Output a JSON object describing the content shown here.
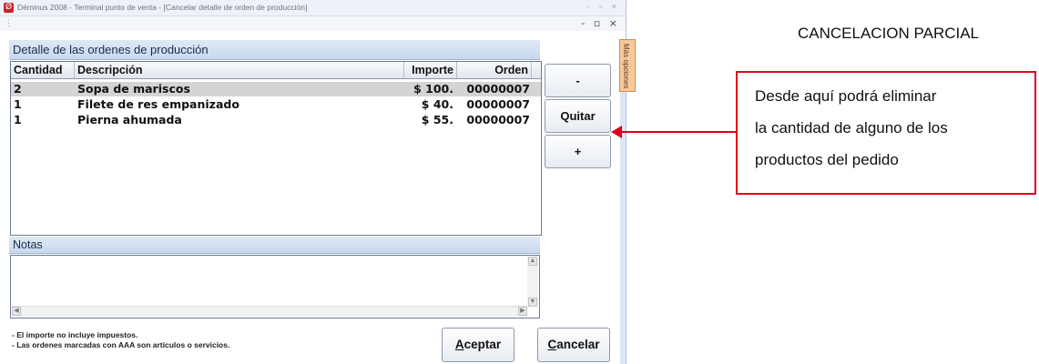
{
  "window": {
    "title": "Déminus 2008 - Terminal punto de venta - [Cancelar detalle de orden de producción]",
    "controls": "- ▫ ×",
    "inner_controls": "- ▫ ×",
    "menu_dots": "⋮"
  },
  "panel": {
    "title": "Detalle de las ordenes de producción",
    "columns": [
      "Cantidad",
      "Descripción",
      "Importe",
      "Orden"
    ],
    "rows": [
      {
        "cantidad": "2",
        "descripcion": "Sopa de mariscos",
        "importe": "$ 100.",
        "orden": "00000007"
      },
      {
        "cantidad": "1",
        "descripcion": "Filete de res empanizado",
        "importe": "$ 40.",
        "orden": "00000007"
      },
      {
        "cantidad": "1",
        "descripcion": "Pierna ahumada",
        "importe": "$ 55.",
        "orden": "00000007"
      }
    ],
    "selected_row": 0
  },
  "side_buttons": {
    "minus": "-",
    "quitar": "Quitar",
    "plus": "+"
  },
  "side_tab": {
    "label": "Más opciones"
  },
  "notes": {
    "title": "Notas",
    "value": ""
  },
  "footer": {
    "note1": "- El importe no incluye impuestos.",
    "note2": "- Las ordenes marcadas con AAA son artículos o servicios.",
    "aceptar_first": "A",
    "aceptar_rest": "ceptar",
    "cancelar_first": "C",
    "cancelar_rest": "ancelar"
  },
  "annotation": {
    "heading": "CANCELACION PARCIAL",
    "lines": [
      "Desde aquí podrá eliminar",
      "la cantidad de alguno de los",
      "productos del pedido"
    ],
    "color": "#e0001b"
  }
}
